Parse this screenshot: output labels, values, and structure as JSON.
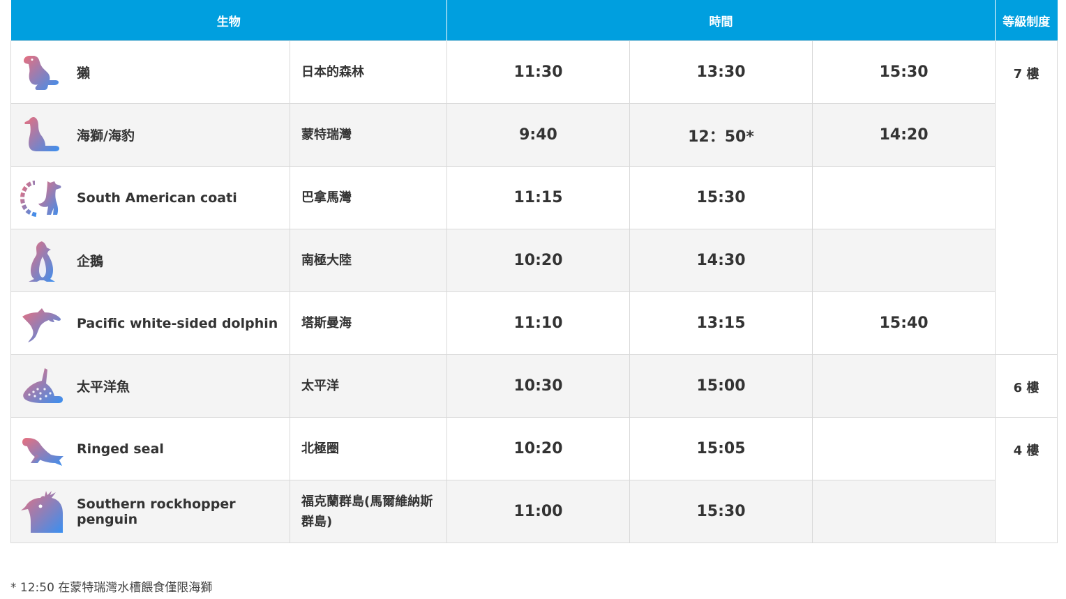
{
  "header": {
    "creature": "生物",
    "time": "時間",
    "floor": "等級制度"
  },
  "colors": {
    "header_bg": "#009fdf",
    "gradient_start": "#e86f7e",
    "gradient_end": "#3a8ff0"
  },
  "rows": [
    {
      "icon": "otter-icon",
      "name": "獺",
      "region": "日本的森林",
      "times": [
        "11:30",
        "13:30",
        "15:30"
      ]
    },
    {
      "icon": "sea-lion-icon",
      "name": "海獅/海豹",
      "region": "蒙特瑞灣",
      "times": [
        "9:40",
        "12：50*",
        "14:20"
      ]
    },
    {
      "icon": "coati-icon",
      "name": "South American coati",
      "region": "巴拿馬灣",
      "times": [
        "11:15",
        "15:30",
        ""
      ]
    },
    {
      "icon": "penguin-icon",
      "name": "企鵝",
      "region": "南極大陸",
      "times": [
        "10:20",
        "14:30",
        ""
      ]
    },
    {
      "icon": "dolphin-icon",
      "name": "Pacific white-sided dolphin",
      "region": "塔斯曼海",
      "times": [
        "11:10",
        "13:15",
        "15:40"
      ]
    },
    {
      "icon": "whale-shark-icon",
      "name": "太平洋魚",
      "region": "太平洋",
      "times": [
        "10:30",
        "15:00",
        ""
      ]
    },
    {
      "icon": "ringed-seal-icon",
      "name": "Ringed seal",
      "region": "北極圈",
      "times": [
        "10:20",
        "15:05",
        ""
      ]
    },
    {
      "icon": "rockhopper-penguin-icon",
      "name": "Southern rockhopper penguin",
      "region": "福克蘭群島(馬爾維納斯群島)",
      "times": [
        "11:00",
        "15:30",
        ""
      ]
    }
  ],
  "floors": [
    "7 樓",
    "6 樓",
    "4 樓"
  ],
  "footnote": "* 12:50 在蒙特瑞灣水槽餵食僅限海獅"
}
